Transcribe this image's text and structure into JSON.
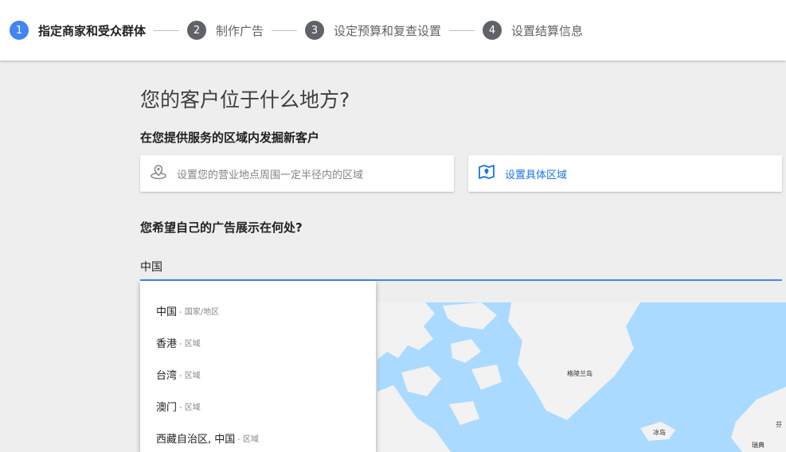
{
  "stepper": {
    "steps": [
      {
        "num": "1",
        "label": "指定商家和受众群体"
      },
      {
        "num": "2",
        "label": "制作广告"
      },
      {
        "num": "3",
        "label": "设定预算和复查设置"
      },
      {
        "num": "4",
        "label": "设置结算信息"
      }
    ]
  },
  "main": {
    "title": "您的客户位于什么地方?",
    "service_area_heading": "在您提供服务的区域内发掘新客户",
    "radius_option_label": "设置您的营业地点周围一定半径内的区域",
    "region_option_label": "设置具体区域",
    "ad_location_heading": "您希望自己的广告展示在何处?"
  },
  "search": {
    "value": "中国"
  },
  "dropdown": {
    "options": [
      {
        "name": "中国",
        "type": "- 国家/地区"
      },
      {
        "name": "香港",
        "type": "- 区域"
      },
      {
        "name": "台湾",
        "type": "- 区域"
      },
      {
        "name": "澳门",
        "type": "- 区域"
      },
      {
        "name": "西藏自治区, 中国",
        "type": "- 区域"
      }
    ]
  },
  "map": {
    "labels": {
      "greenland": "格陵兰岛",
      "iceland": "冰岛",
      "sweden": "瑞典",
      "other": "芬"
    }
  },
  "colors": {
    "accent": "#4285f4",
    "link": "#1a73e8",
    "water": "#aadaff",
    "land": "#f2f2f2"
  }
}
